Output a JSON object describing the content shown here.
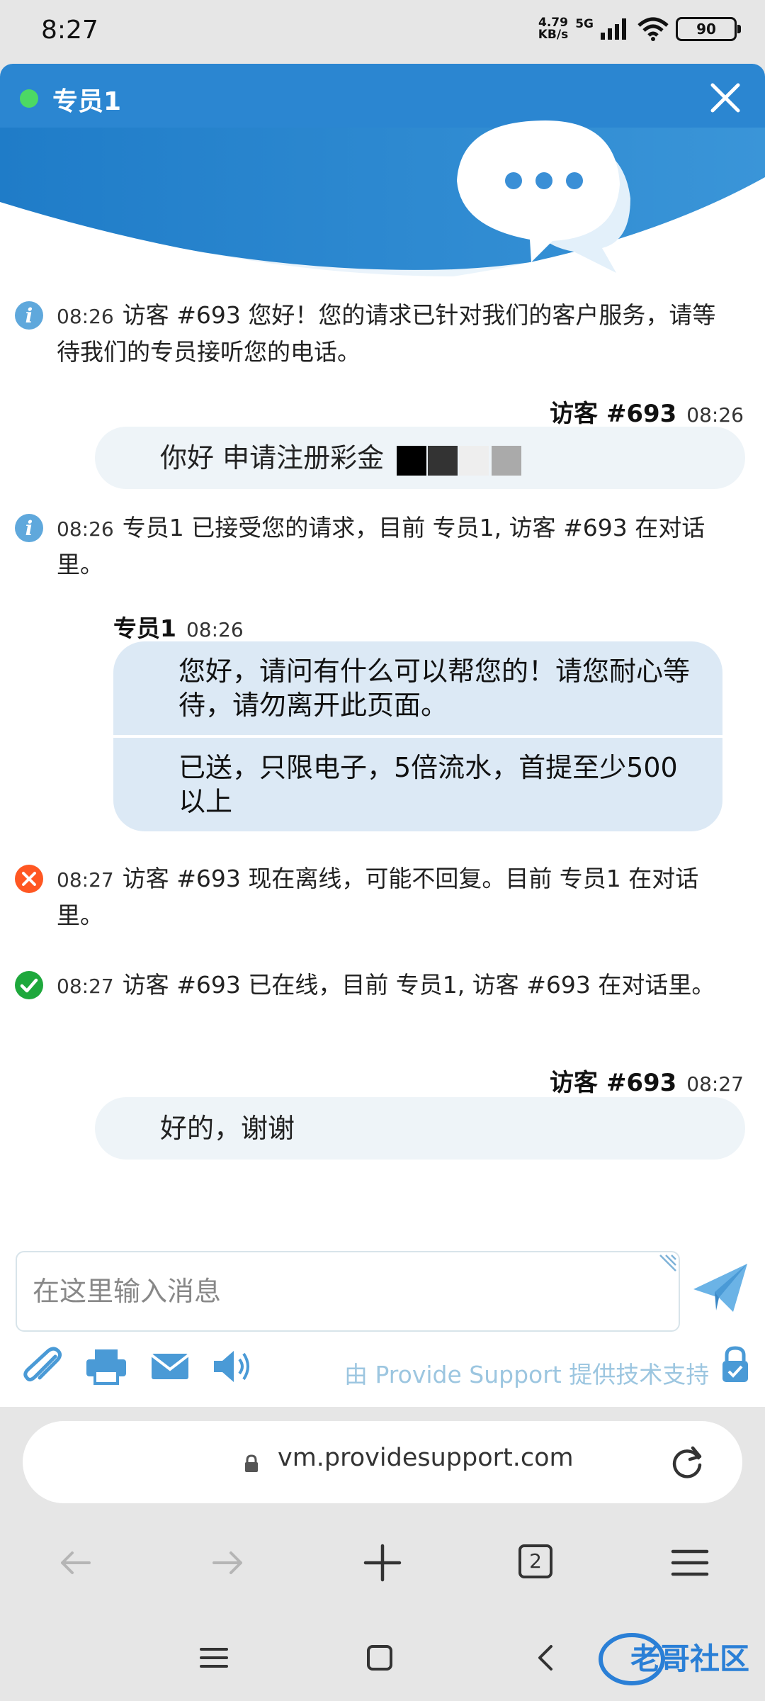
{
  "status_bar": {
    "time": "8:27",
    "speed_value": "4.79",
    "speed_unit": "KB/s",
    "network": "5G",
    "battery": "90"
  },
  "chat": {
    "agent_name": "专员1",
    "messages": [
      {
        "kind": "info",
        "time": "08:26",
        "text": "访客 #693 您好！您的请求已针对我们的客户服务，请等待我们的专员接听您的电话。"
      },
      {
        "kind": "visitor",
        "author": "访客 #693",
        "time": "08:26",
        "text": "你好 申请注册彩金"
      },
      {
        "kind": "info",
        "time": "08:26",
        "text": "专员1 已接受您的请求，目前 专员1, 访客 #693 在对话里。"
      },
      {
        "kind": "agent",
        "author": "专员1",
        "time": "08:26",
        "parts": [
          "您好，请问有什么可以帮您的！请您耐心等待，请勿离开此页面。",
          "已送，只限电子，5倍流水，首提至少500以上"
        ]
      },
      {
        "kind": "offline",
        "time": "08:27",
        "text": "访客 #693 现在离线，可能不回复。目前 专员1 在对话里。"
      },
      {
        "kind": "online",
        "time": "08:27",
        "text": "访客 #693 已在线，目前 专员1, 访客 #693 在对话里。"
      },
      {
        "kind": "visitor",
        "author": "访客 #693",
        "time": "08:27",
        "text": "好的，谢谢"
      }
    ],
    "input_placeholder": "在这里输入消息",
    "powered_by": "由 Provide Support 提供技术支持"
  },
  "colors": {
    "header_blue": "#2b86d1",
    "online_green": "#4cd964",
    "info_blue": "#5fa8dc",
    "offline_orange": "#ff5722",
    "online_ok_green": "#1ea83c"
  },
  "browser": {
    "url": "vm.providesupport.com",
    "tab_count": "2"
  },
  "watermark": "老哥社区"
}
